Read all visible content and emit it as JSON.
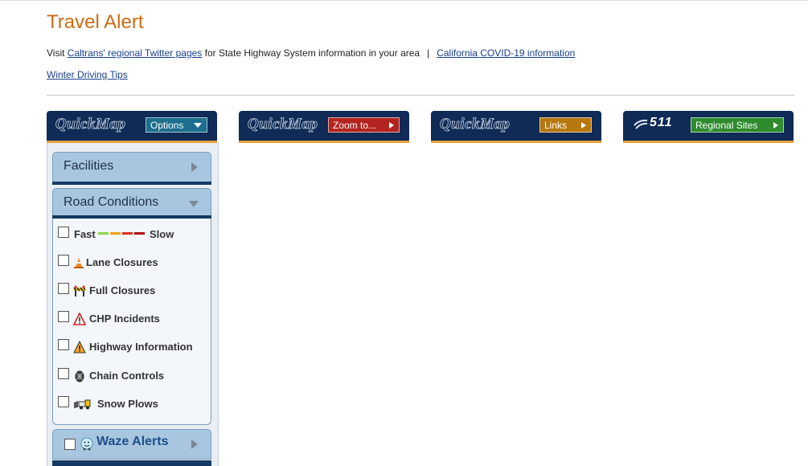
{
  "page": {
    "title": "Travel Alert",
    "visit_prefix": "Visit ",
    "twitter_link": "Caltrans' regional Twitter pages",
    "visit_suffix": " for State Highway System information in your area",
    "separator": "|",
    "covid_link": "California COVID-19 information",
    "winter_link": "Winter Driving Tips"
  },
  "quickbars": [
    {
      "logo": "QuickMap",
      "button": "Options",
      "button_color": "#1d6f8f"
    },
    {
      "logo": "QuickMap",
      "button": "Zoom to...",
      "button_color": "#b3241f"
    },
    {
      "logo": "QuickMap",
      "button": "Links",
      "button_color": "#b8780f"
    },
    {
      "logo": "511",
      "button": "Regional Sites",
      "button_color": "#2e8b2e"
    }
  ],
  "panel": {
    "facilities": "Facilities",
    "road_conditions": "Road Conditions",
    "items": [
      {
        "label": "Fast",
        "label2": "Slow",
        "icon": "speed-legend"
      },
      {
        "label": "Lane Closures",
        "icon": "cone-icon"
      },
      {
        "label": "Full Closures",
        "icon": "barricade-icon"
      },
      {
        "label": "CHP Incidents",
        "icon": "warning-red-icon"
      },
      {
        "label": "Highway Information",
        "icon": "warning-orange-icon"
      },
      {
        "label": "Chain Controls",
        "icon": "tire-chain-icon"
      },
      {
        "label": "Snow Plows",
        "icon": "snow-plow-icon"
      }
    ],
    "waze": "Waze Alerts",
    "legend_colors": [
      "#8cd44a",
      "#f0a020",
      "#e03020",
      "#b01010"
    ]
  }
}
